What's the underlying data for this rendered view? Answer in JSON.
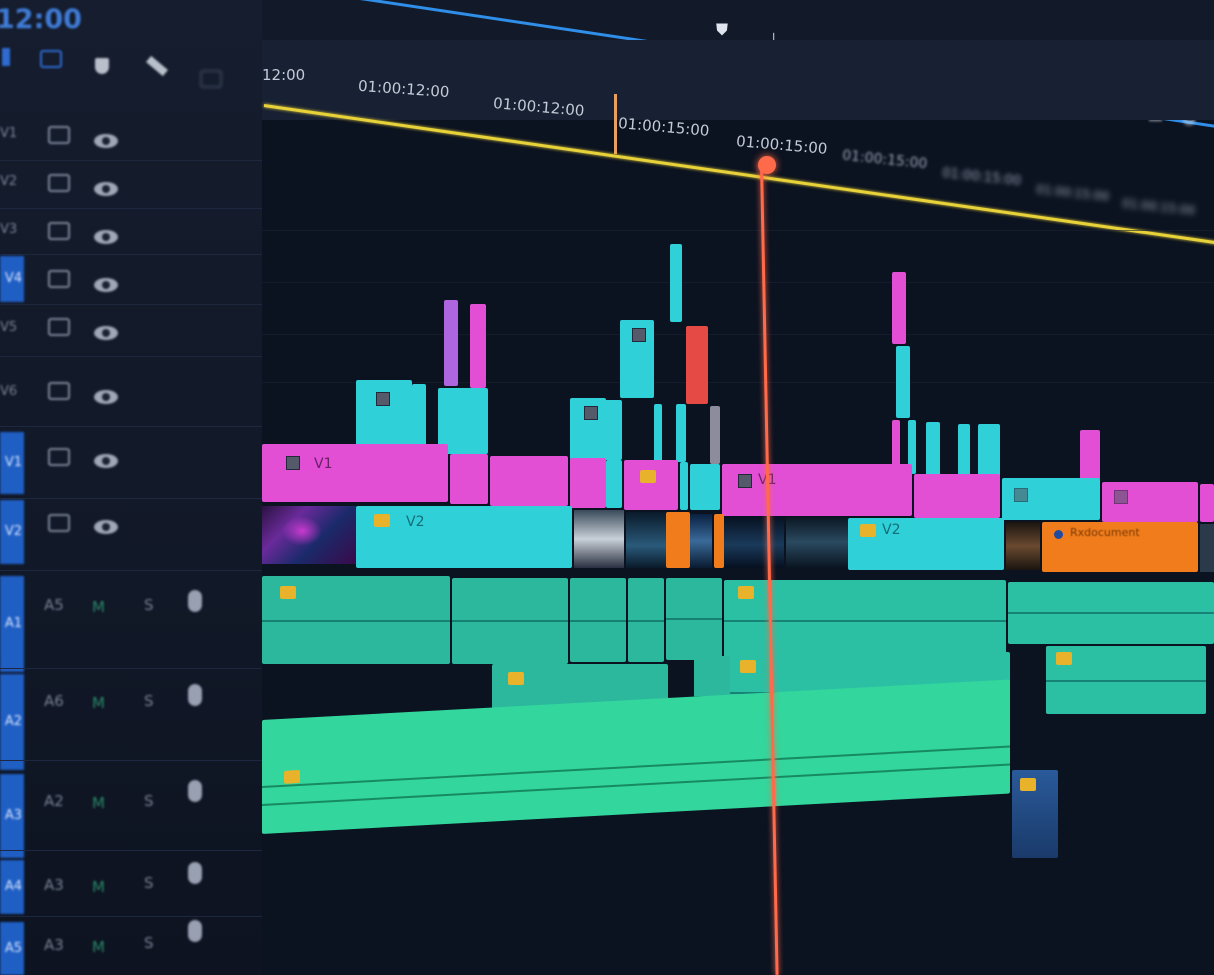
{
  "window": {
    "timecode": "12:00"
  },
  "header_controls": {
    "icons": [
      "marker-icon",
      "in-point-icon",
      "out-point-icon",
      "go-to-in-icon",
      "step-back-icon",
      "play-icon",
      "step-forward-icon",
      "go-to-out-icon",
      "lift-icon",
      "extract-icon",
      "export-frame-icon",
      "settings-icon"
    ]
  },
  "ruler": {
    "ticks": [
      "12:00",
      "01:00:12:00",
      "01:00:12:00",
      "01:00:15:00",
      "01:00:15:00",
      "01:00:15:00",
      "01:00:15:00",
      "01:00:15:00",
      "01:00:15:00"
    ]
  },
  "video_tracks": [
    {
      "label": "V1"
    },
    {
      "label": "V2"
    },
    {
      "label": "V3"
    },
    {
      "label": "V4"
    },
    {
      "label": "V5"
    },
    {
      "label": "V6"
    },
    {
      "label": "V1"
    },
    {
      "label": "V2"
    }
  ],
  "audio_tracks": [
    {
      "label": "A1",
      "s": "S"
    },
    {
      "label": "A2",
      "s": "S"
    },
    {
      "label": "A3",
      "s": "S"
    },
    {
      "label": "A4",
      "s": "S"
    },
    {
      "label": "A5",
      "s": "S"
    }
  ],
  "clips": {
    "v1_label_a": "V1",
    "v1_label_b": "V1",
    "v2_label_a": "V2",
    "v2_label_b": "V2",
    "orange_clip_label": "Rxdocument"
  },
  "colors": {
    "cyan": "#2fd0d8",
    "pink": "#e24fd4",
    "orange": "#f07c1c",
    "audio": "#2ec7a8",
    "playhead": "#ff6a4a",
    "work_area": "#e8d23a",
    "accent": "#1f5fc4"
  }
}
